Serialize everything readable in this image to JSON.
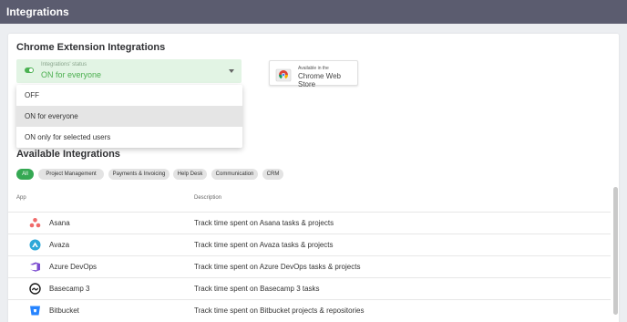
{
  "header": {
    "title": "Integrations"
  },
  "chrome": {
    "title": "Chrome Extension Integrations",
    "status_caption": "Integrations' status",
    "status_value": "ON for everyone",
    "options": [
      "OFF",
      "ON for everyone",
      "ON only for selected users"
    ],
    "store_line1": "Available in the",
    "store_line2": "Chrome Web Store"
  },
  "available": {
    "title": "Available Integrations",
    "chips": [
      "All",
      "Project Management",
      "Payments & Invoicing",
      "Help Desk",
      "Communication",
      "CRM"
    ],
    "columns": [
      "App",
      "Description"
    ],
    "rows": [
      {
        "name": "Asana",
        "desc": "Track time spent on Asana tasks & projects",
        "icon": "asana-icon"
      },
      {
        "name": "Avaza",
        "desc": "Track time spent on Avaza tasks & projects",
        "icon": "avaza-icon"
      },
      {
        "name": "Azure DevOps",
        "desc": "Track time spent on Azure DevOps tasks & projects",
        "icon": "azure-devops-icon"
      },
      {
        "name": "Basecamp 3",
        "desc": "Track time spent on Basecamp 3 tasks",
        "icon": "basecamp-icon"
      },
      {
        "name": "Bitbucket",
        "desc": "Track time spent on Bitbucket projects & repositories",
        "icon": "bitbucket-icon"
      }
    ]
  },
  "colors": {
    "topbar": "#5b5c6f",
    "accent": "#35a853",
    "status_bg": "#e2f4e4"
  }
}
